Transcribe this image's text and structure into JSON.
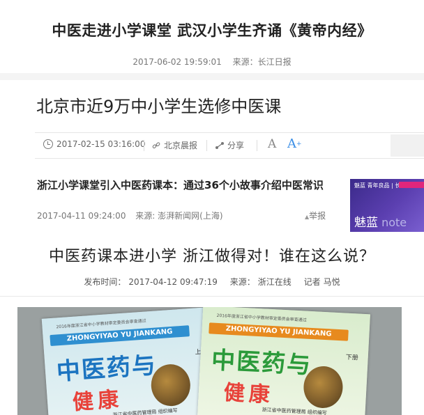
{
  "article1": {
    "title": "中医走进小学课堂 武汉小学生齐诵《黄帝内经》",
    "datetime": "2017-06-02 19:59:01",
    "source_label": "来源：",
    "source": "长江日报"
  },
  "article2": {
    "title": "北京市近9万中小学生选修中医课",
    "datetime": "2017-02-15 03:16:00",
    "source": "北京晨报",
    "share_label": "分享",
    "font_small": "A",
    "font_large": "A",
    "font_large_sup": "+"
  },
  "article3": {
    "title": "浙江小学课堂引入中医药课本：通过36个小故事介绍中医常识",
    "datetime": "2017-04-11 09:24:00",
    "source": "来源: 澎湃新闻网(上海)",
    "report_label": "举报",
    "ad": {
      "top_text": "魅蓝 青年良品 | 长续航",
      "brand": "魅蓝",
      "brand_suffix": " note"
    }
  },
  "article4": {
    "title": "中医药课本进小学 浙江做得对！谁在这么说？",
    "publish_label": "发布时间：",
    "datetime": "2017-04-12 09:47:19",
    "source_label": "来源：",
    "source": "浙江在线",
    "author_label": "记者",
    "author": "马悦"
  },
  "photo": {
    "book1": {
      "small_text": "2016年度浙江省中小学教材审定委员会审查通过",
      "ribbon": "ZHONGYIYAO YU JIANKANG",
      "title": "中医药与",
      "title2": "健康",
      "volume": "上册",
      "publisher": "浙江省中医药管理局 组织编写"
    },
    "book2": {
      "small_text": "2016年度浙江省中小学教材审定委员会审查通过",
      "ribbon": "ZHONGYIYAO YU JIANKANG",
      "title": "中医药与",
      "title2": "健康",
      "volume": "下册",
      "publisher": "浙江省中医药管理局 组织编写"
    }
  },
  "colors": {
    "accent_blue": "#3a8ee6",
    "ad_purple": "#5b3fb0"
  }
}
